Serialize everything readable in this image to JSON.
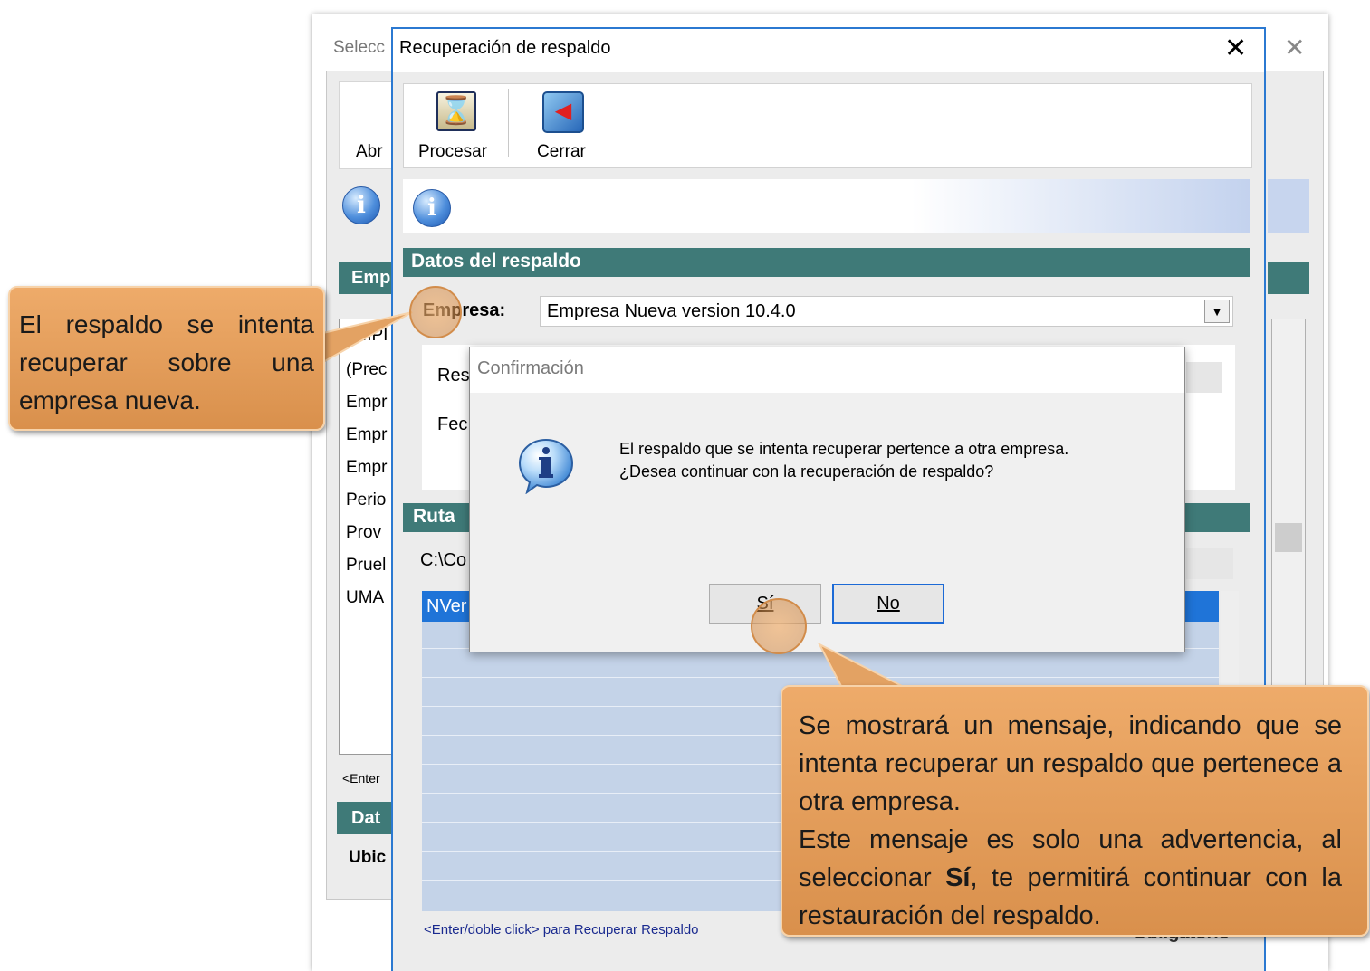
{
  "background_window": {
    "title": "Selecc",
    "close": "✕",
    "toolbar_label": "Abr",
    "section": "Emp",
    "list_items": [
      "EMPI",
      "(Prec",
      "Empr",
      "Empr",
      "Empr",
      "Perio",
      "Prov",
      "Pruel",
      "UMA"
    ],
    "hint": "<Enter",
    "section2": "Dat",
    "field": "Ubic"
  },
  "main_dialog": {
    "title": "Recuperación de respaldo",
    "close": "✕",
    "toolbar": {
      "procesar": "Procesar",
      "cerrar": "Cerrar"
    },
    "section_datos": "Datos del respaldo",
    "empresa_label": "Empresa:",
    "empresa_value": "Empresa Nueva version 10.4.0",
    "res_label": "Res",
    "fec_label": "Fec",
    "section_ruta": "Ruta",
    "path_value": "C:\\Co",
    "selected_row": "NVer",
    "footer_hint": "<Enter/doble click> para Recuperar Respaldo",
    "footer_obligatorio": "* Obligatorio"
  },
  "confirm_dialog": {
    "title": "Confirmación",
    "line1": "El respaldo que se intenta recuperar pertence a otra empresa.",
    "line2": "¿Desea continuar con la recuperación de respaldo?",
    "yes_label": "Sí",
    "no_label": "No"
  },
  "callout_left": {
    "text": "El respaldo se intenta recuperar sobre una empresa nueva."
  },
  "callout_right": {
    "p1": "Se mostrará un mensaje, indicando que se intenta recuperar un respaldo que pertenece a otra empresa.",
    "p2_before": "Este mensaje es solo una advertencia, al seleccionar ",
    "p2_bold": "Sí",
    "p2_after": ", te permitirá continuar con la restauración del respaldo."
  },
  "colors": {
    "section_header": "#3f7a78",
    "selection": "#1f74d8",
    "callout": "#e59d5b",
    "window_border": "#2b79d1"
  },
  "icons": [
    "hourglass-icon",
    "exit-door-icon",
    "info-icon",
    "close-icon",
    "dropdown-arrow-icon",
    "info-balloon-icon"
  ]
}
